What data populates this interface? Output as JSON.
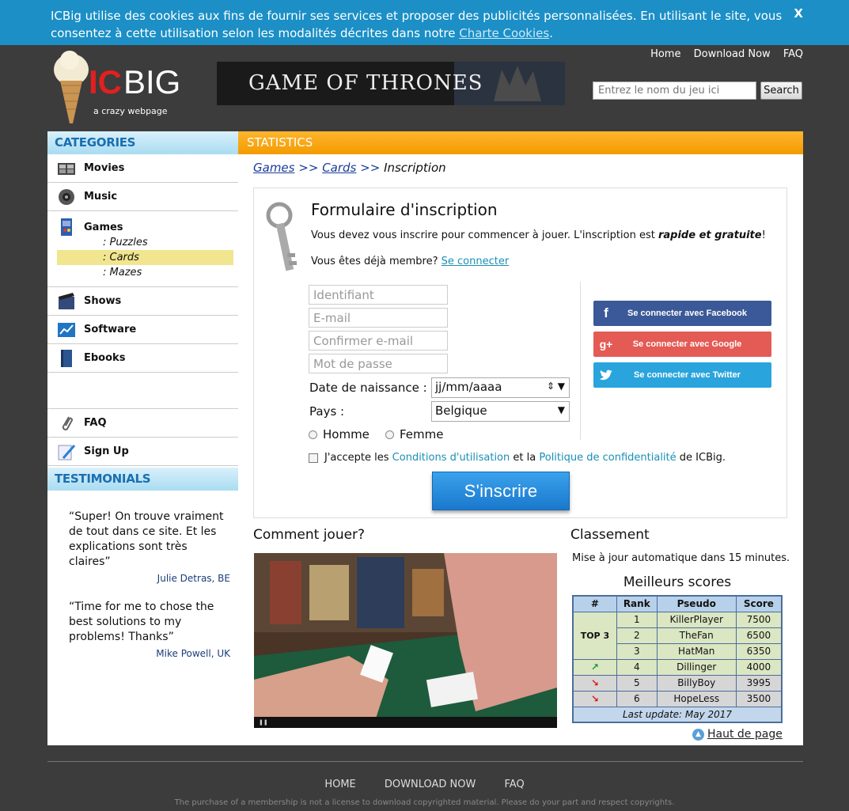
{
  "cookie": {
    "text": "ICBig utilise des cookies aux fins de fournir ses services et proposer des publicités personnalisées. En utilisant le site, vous consentez à cette utilisation selon les modalités décrites dans notre",
    "link": "Charte Cookies",
    "close": "X"
  },
  "header": {
    "logo_text": "ICBIG",
    "logo_tagline": "a crazy webpage",
    "banner_text": "GAME OF THRONES",
    "nav": [
      "Home",
      "Download Now",
      "FAQ"
    ],
    "search_placeholder": "Entrez le nom du jeu ici",
    "search_button": "Search"
  },
  "sidebar": {
    "categories_title": "CATEGORIES",
    "items": [
      {
        "label": "Movies",
        "icon": "film-icon"
      },
      {
        "label": "Music",
        "icon": "speaker-icon"
      },
      {
        "label": "Games",
        "icon": "arcade-icon"
      },
      {
        "label": "Shows",
        "icon": "clapperboard-icon"
      },
      {
        "label": "Software",
        "icon": "chart-icon"
      },
      {
        "label": "Ebooks",
        "icon": "book-icon"
      }
    ],
    "games_sub": [
      ": Puzzles",
      ": Cards",
      ": Mazes"
    ],
    "extra": [
      {
        "label": "FAQ",
        "icon": "paperclip-icon"
      },
      {
        "label": "Sign Up",
        "icon": "pen-icon"
      }
    ],
    "testimonials_title": "TESTIMONIALS",
    "testimonials": [
      {
        "quote": "“Super! On trouve vraiment de tout dans ce site. Et les explications sont très claires”",
        "author": "Julie Detras, BE"
      },
      {
        "quote": "“Time for me to chose the best solutions to my problems! Thanks”",
        "author": "Mike Powell, UK"
      }
    ]
  },
  "content": {
    "section_title": "STATISTICS",
    "breadcrumb": {
      "games": "Games",
      "sep": ">>",
      "cards": "Cards",
      "current": "Inscription"
    },
    "form": {
      "title": "Formulaire d'inscription",
      "intro": "Vous devez vous inscrire pour commencer à jouer. L'inscription est",
      "intro_bold": "rapide et gratuite",
      "intro_end": "!",
      "member": "Vous êtes déjà membre?",
      "member_link": "Se connecter",
      "placeholders": {
        "id": "Identifiant",
        "email": "E-mail",
        "confirm": "Confirmer e-mail",
        "password": "Mot de passe"
      },
      "birth_label": "Date de naissance :",
      "birth_value": "jj/mm/aaaa",
      "country_label": "Pays :",
      "country_value": "Belgique",
      "gender_male": "Homme",
      "gender_female": "Femme",
      "accept_1": "J'accepte les",
      "accept_terms": "Conditions d'utilisation",
      "accept_2": "et la",
      "accept_privacy": "Politique de confidentialité",
      "accept_3": "de ICBig.",
      "submit": "S'inscrire",
      "social": [
        {
          "label": "Se connecter avec Facebook",
          "icon": "facebook-icon",
          "color": "#3b5998",
          "glyph": "f"
        },
        {
          "label": "Se connecter avec Google",
          "icon": "google-plus-icon",
          "color": "#e45a55",
          "glyph": "g+"
        },
        {
          "label": "Se connecter avec Twitter",
          "icon": "twitter-icon",
          "color": "#2aa4dc",
          "glyph": "t"
        }
      ]
    },
    "how_title": "Comment jouer?",
    "ranking": {
      "title": "Classement",
      "note": "Mise à jour automatique dans 15 minutes.",
      "best": "Meilleurs scores",
      "headers": [
        "#",
        "Rank",
        "Pseudo",
        "Score"
      ],
      "top_label": "TOP 3",
      "rows": [
        {
          "rank": "1",
          "pseudo": "KillerPlayer",
          "score": "7500"
        },
        {
          "rank": "2",
          "pseudo": "TheFan",
          "score": "6500"
        },
        {
          "rank": "3",
          "pseudo": "HatMan",
          "score": "6350"
        },
        {
          "rank": "4",
          "pseudo": "Dillinger",
          "score": "4000",
          "trend": "up-arrow-icon"
        },
        {
          "rank": "5",
          "pseudo": "BillyBoy",
          "score": "3995",
          "trend": "down-arrow-icon"
        },
        {
          "rank": "6",
          "pseudo": "HopeLess",
          "score": "3500",
          "trend": "down-arrow-icon"
        }
      ],
      "last_update": "Last update: May 2017"
    },
    "back_top": "Haut de page"
  },
  "footer": {
    "nav": [
      "HOME",
      "DOWNLOAD NOW",
      "FAQ"
    ],
    "copyright": "The purchase of a membership is not a license to download copyrighted material. Please do your part and respect copyrights."
  }
}
